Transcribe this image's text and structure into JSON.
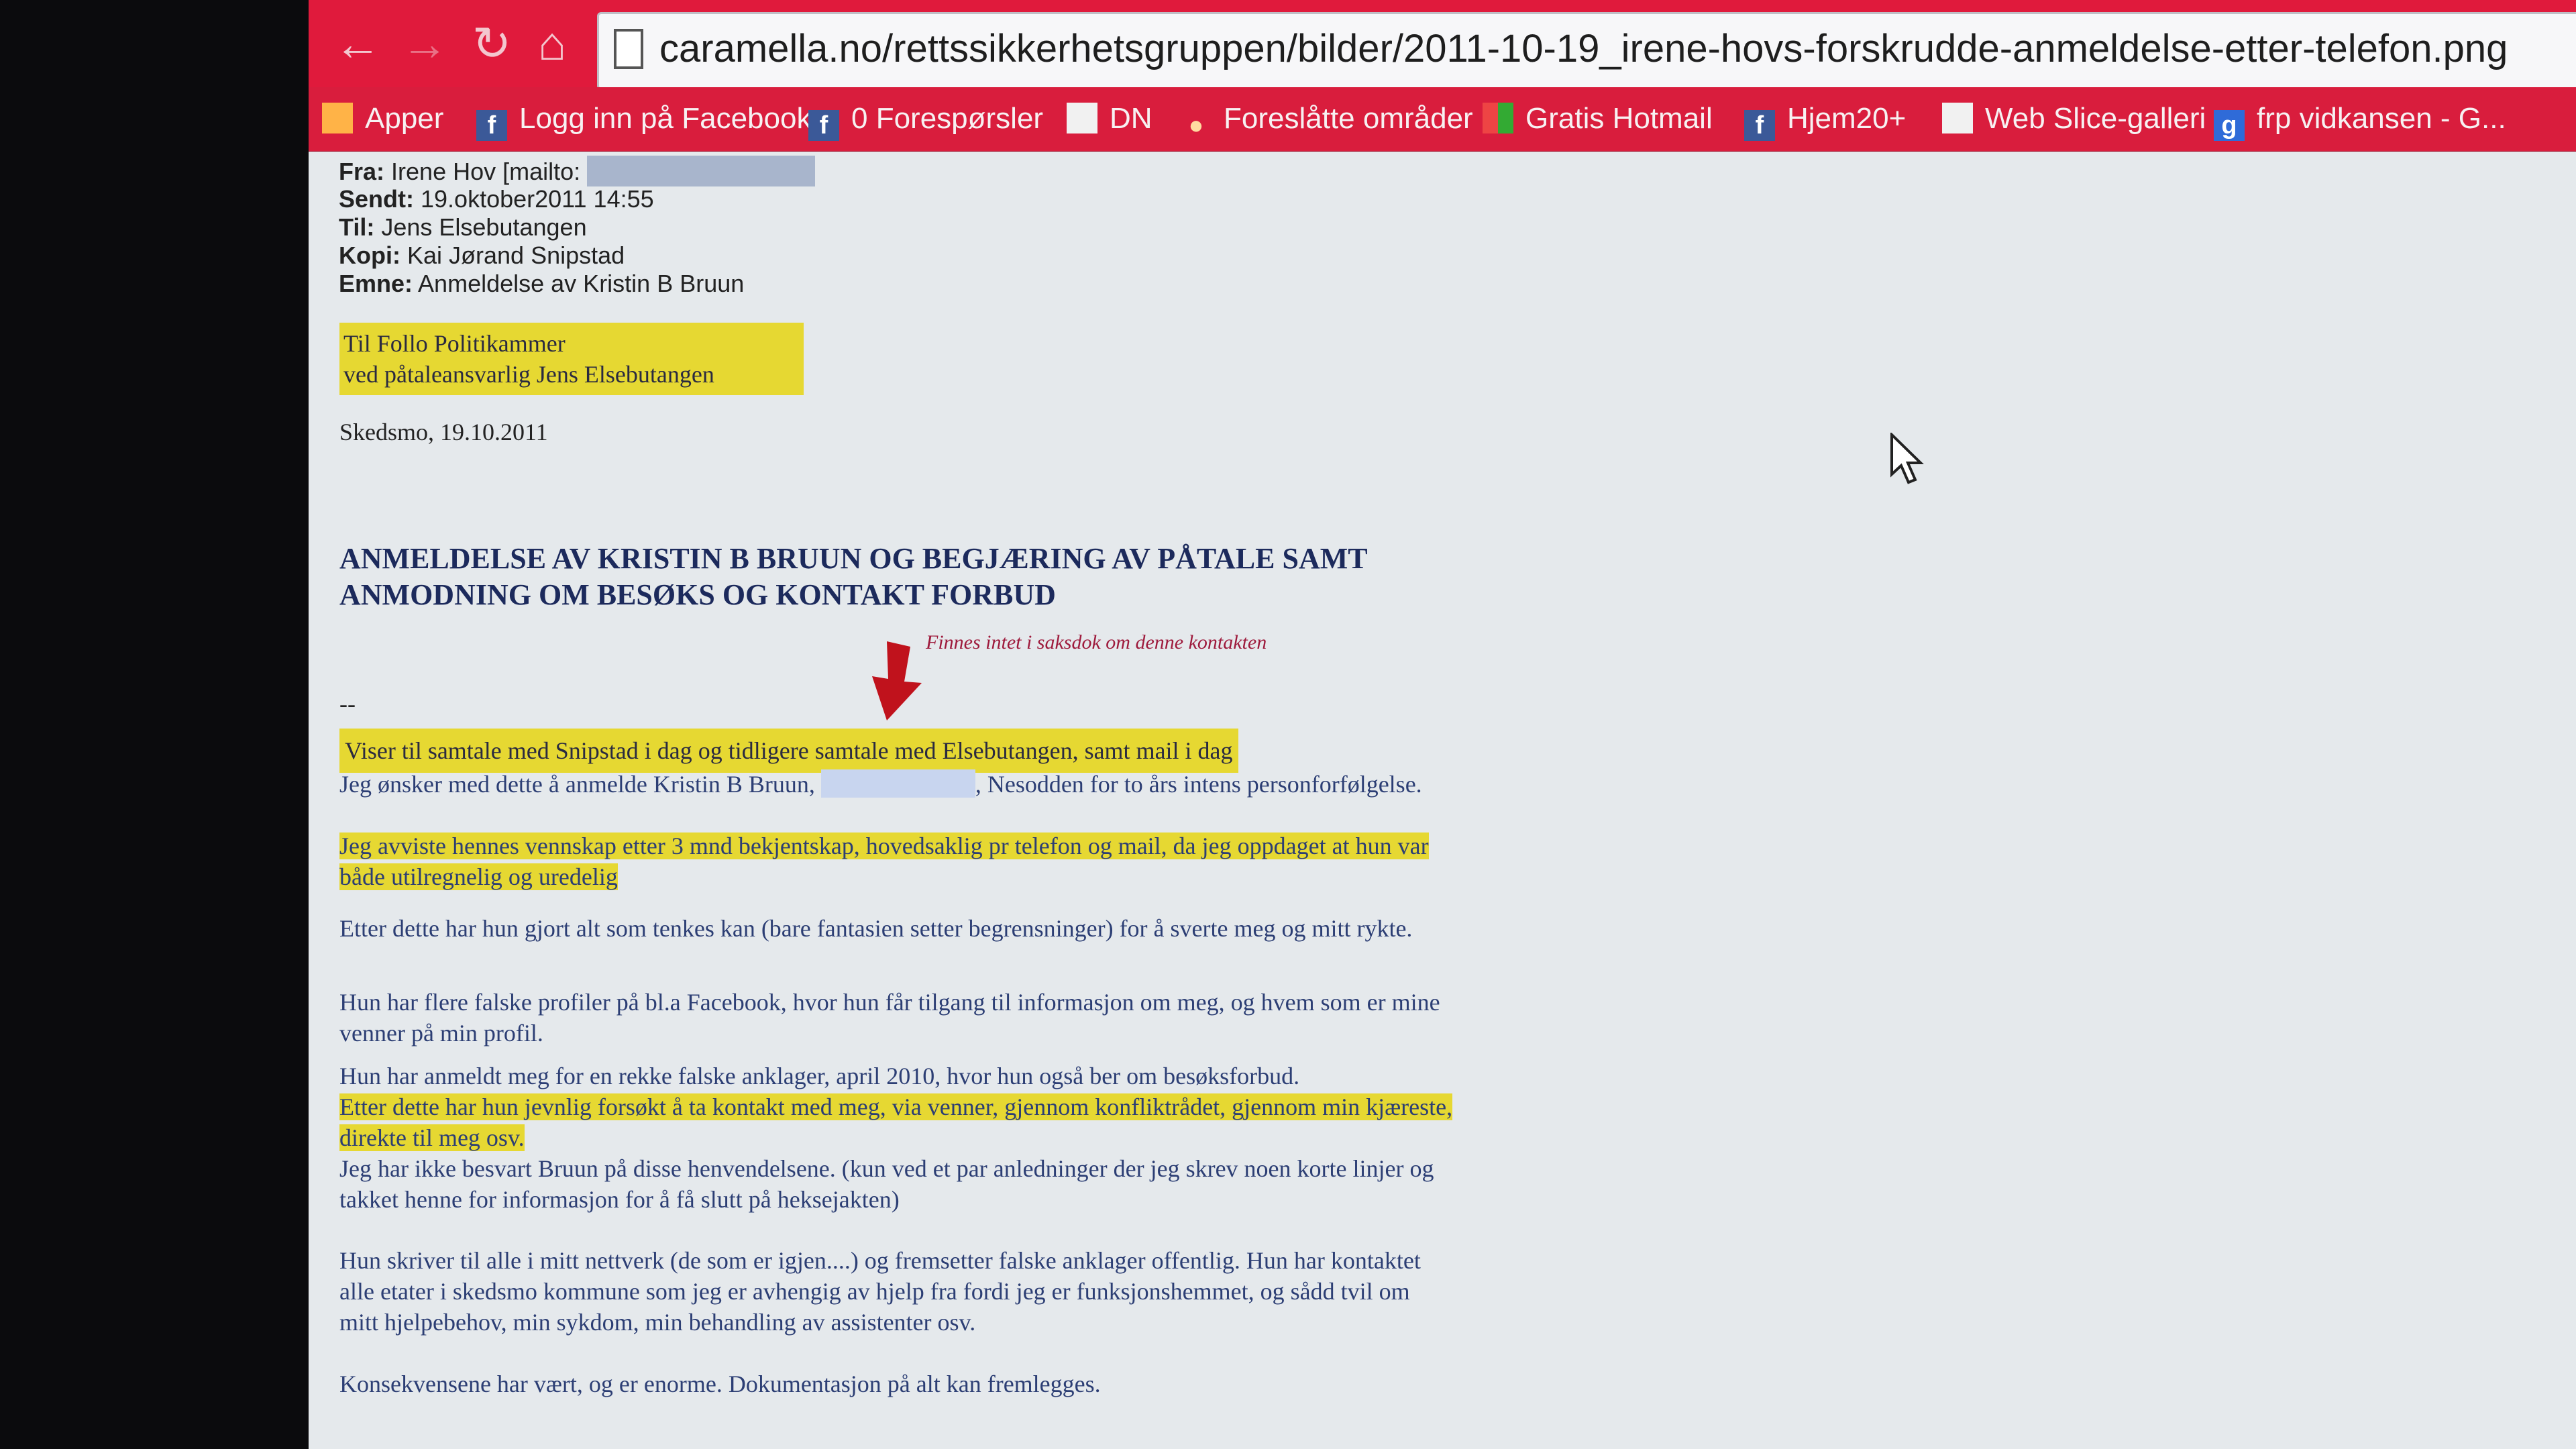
{
  "browser": {
    "url": "caramella.no/rettssikkerhetsgruppen/bilder/2011-10-19_irene-hovs-forskrudde-anmeldelse-etter-telefon.png",
    "bookmarks": [
      {
        "label": "Apper",
        "icon": "apps-icon"
      },
      {
        "label": "Logg inn på Facebook",
        "icon": "facebook-icon"
      },
      {
        "label": "0 Forespørsler",
        "icon": "facebook-icon"
      },
      {
        "label": "DN",
        "icon": "page-icon"
      },
      {
        "label": "Foreslåtte områder",
        "icon": "pin-icon"
      },
      {
        "label": "Gratis Hotmail",
        "icon": "msn-icon"
      },
      {
        "label": "Hjem20+",
        "icon": "facebook-icon"
      },
      {
        "label": "Web Slice-galleri",
        "icon": "page-icon"
      },
      {
        "label": "frp vidkansen - G...",
        "icon": "google-icon"
      }
    ]
  },
  "email_header": {
    "from_label": "Fra:",
    "from_value": "Irene Hov [mailto:",
    "sent_label": "Sendt:",
    "sent_value": "19.oktober2011 14:55",
    "to_label": "Til:",
    "to_value": "Jens Elsebutangen",
    "cc_label": "Kopi:",
    "cc_value": "Kai Jørand Snipstad",
    "subject_label": "Emne:",
    "subject_value": "Anmeldelse av Kristin B Bruun"
  },
  "letter": {
    "recipient_line1": "Til Follo Politikammer",
    "recipient_line2": "ved påtaleansvarlig Jens Elsebutangen",
    "place_date": "Skedsmo, 19.10.2011",
    "title_line1": "ANMELDELSE AV KRISTIN B BRUUN OG BEGJÆRING AV PÅTALE SAMT",
    "title_line2": "ANMODNING OM BESØKS OG KONTAKT FORBUD",
    "annotation": "Finnes intet i saksdok om denne kontakten",
    "dash": "--",
    "p1": "Viser til samtale med Snipstad i dag og tidligere samtale med Elsebutangen, samt mail i dag",
    "p2a": "Jeg ønsker med dette å anmelde Kristin B Bruun,",
    "p2b": ", Nesodden for to års intens personforfølgelse.",
    "p3": "Jeg avviste hennes vennskap etter 3 mnd bekjentskap, hovedsaklig pr telefon og mail, da jeg oppdaget at hun var både utilregnelig og uredelig",
    "p4": "Etter dette har hun gjort alt som tenkes kan (bare fantasien setter begrensninger) for å sverte meg og mitt rykte.",
    "p5": "Hun har flere falske profiler på bl.a Facebook, hvor hun får tilgang til informasjon om meg, og hvem som er mine venner på min profil.",
    "p6": "Hun har anmeldt meg for en rekke falske anklager, april 2010, hvor hun også ber om besøksforbud.",
    "p7": "Etter dette har hun jevnlig forsøkt å ta kontakt med meg, via venner, gjennom konfliktrådet, gjennom min kjæreste, direkte til meg osv.",
    "p8": "Jeg har ikke besvart Bruun på disse henvendelsene. (kun ved et par anledninger der jeg skrev noen korte linjer og takket henne for informasjon for å få slutt på heksejakten)",
    "p9": "Hun skriver til alle i mitt nettverk (de som er igjen....) og fremsetter falske anklager offentlig. Hun har kontaktet alle etater i skedsmo kommune som jeg er avhengig av hjelp fra fordi jeg er funksjonshemmet, og sådd tvil om mitt hjelpebehov, min sykdom, min behandling av assistenter osv.",
    "p10": "Konsekvensene har vært, og er enorme. Dokumentasjon på alt kan fremlegges."
  },
  "colors": {
    "toolbar": "#e01a3c",
    "highlight": "#e6d832",
    "text": "#2c3e74"
  }
}
